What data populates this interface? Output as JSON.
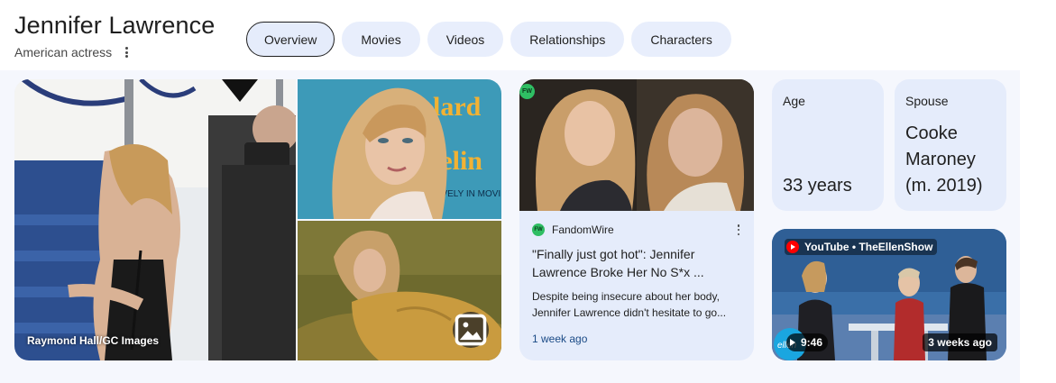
{
  "header": {
    "title": "Jennifer Lawrence",
    "subtitle": "American actress"
  },
  "chips": [
    {
      "label": "Overview",
      "active": true
    },
    {
      "label": "Movies",
      "active": false
    },
    {
      "label": "Videos",
      "active": false
    },
    {
      "label": "Relationships",
      "active": false
    },
    {
      "label": "Characters",
      "active": false
    }
  ],
  "images": {
    "main_credit": "Raymond Hall/GC Images",
    "gallery_icon": "image-gallery-icon"
  },
  "news": {
    "badge": "FW",
    "source": "FandomWire",
    "title": "\"Finally just got hot\": Jennifer Lawrence Broke Her No S*x ...",
    "snippet": "Despite being insecure about her body, Jennifer Lawrence didn't hesitate to go...",
    "date": "1 week ago"
  },
  "facts": {
    "age_label": "Age",
    "age_value": "33 years",
    "spouse_label": "Spouse",
    "spouse_value": "Cooke Maroney (m. 2019)"
  },
  "video": {
    "source": "YouTube • TheEllenShow",
    "duration": "9:46",
    "age": "3 weeks ago"
  },
  "colors": {
    "chip_bg": "#e8eefc",
    "card_bg": "#e5ecfb",
    "panel_bg": "#f5f7fd",
    "link": "#1a4a86"
  }
}
